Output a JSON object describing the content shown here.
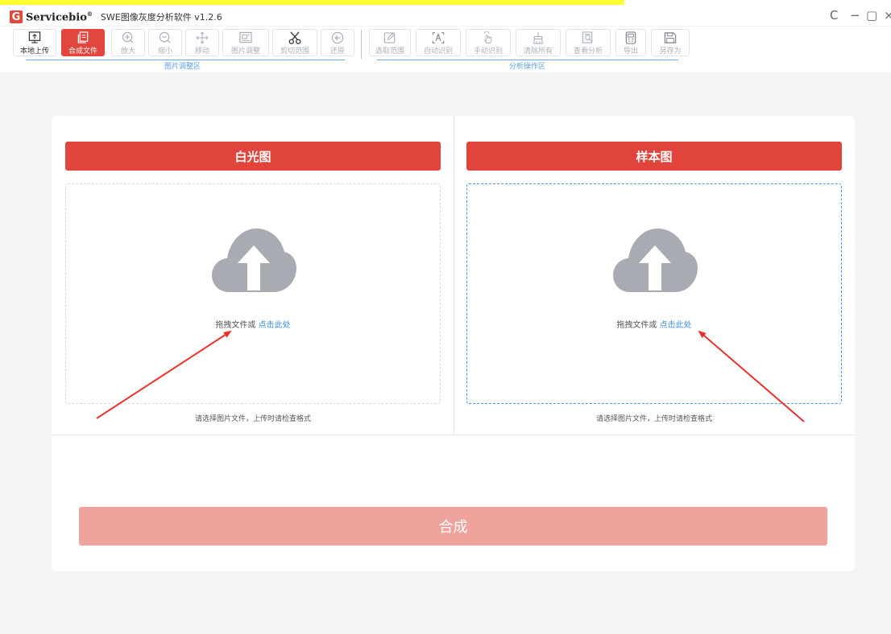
{
  "titlebar": {
    "logo_letter": "G",
    "brand": "Servicebio",
    "brand_mark": "®",
    "app_title": "SWE图像灰度分析软件 v1.2.6",
    "controls": {
      "refresh": "C",
      "minimize": "−",
      "maximize": "▢",
      "close": "×"
    }
  },
  "toolbar": {
    "buttons": [
      {
        "label": "本地上传",
        "icon": "monitor-upload-icon"
      },
      {
        "label": "合成文件",
        "icon": "merge-file-icon"
      },
      {
        "label": "放大",
        "icon": "zoom-in-icon"
      },
      {
        "label": "缩小",
        "icon": "zoom-out-icon"
      },
      {
        "label": "移动",
        "icon": "move-icon"
      },
      {
        "label": "图片调整",
        "icon": "image-adjust-icon"
      },
      {
        "label": "剪切范围",
        "icon": "scissors-icon"
      },
      {
        "label": "还原",
        "icon": "restore-icon"
      },
      {
        "label": "选取范围",
        "icon": "edit-icon"
      },
      {
        "label": "自动识别",
        "icon": "auto-detect-icon"
      },
      {
        "label": "手动识别",
        "icon": "hand-icon"
      },
      {
        "label": "清除所有",
        "icon": "broom-icon"
      },
      {
        "label": "查看分析",
        "icon": "view-analysis-icon"
      },
      {
        "label": "导出",
        "icon": "export-icon"
      },
      {
        "label": "另存为",
        "icon": "save-icon"
      }
    ],
    "groups": {
      "image_adjust": "图片调整区",
      "analysis": "分析操作区"
    }
  },
  "panels": {
    "left": {
      "title": "白光图",
      "drop_text": "拖拽文件或 ",
      "drop_link": "点击此处",
      "hint": "请选择图片文件，上传时请检查格式"
    },
    "right": {
      "title": "样本图",
      "drop_text": "拖拽文件或 ",
      "drop_link": "点击此处",
      "hint": "请选择图片文件，上传时请检查格式"
    }
  },
  "submit_label": "合成",
  "colors": {
    "accent": "#e0443a",
    "submit_disabled": "#eea39c",
    "link": "#3f8fde",
    "arrow": "#e8322a"
  }
}
